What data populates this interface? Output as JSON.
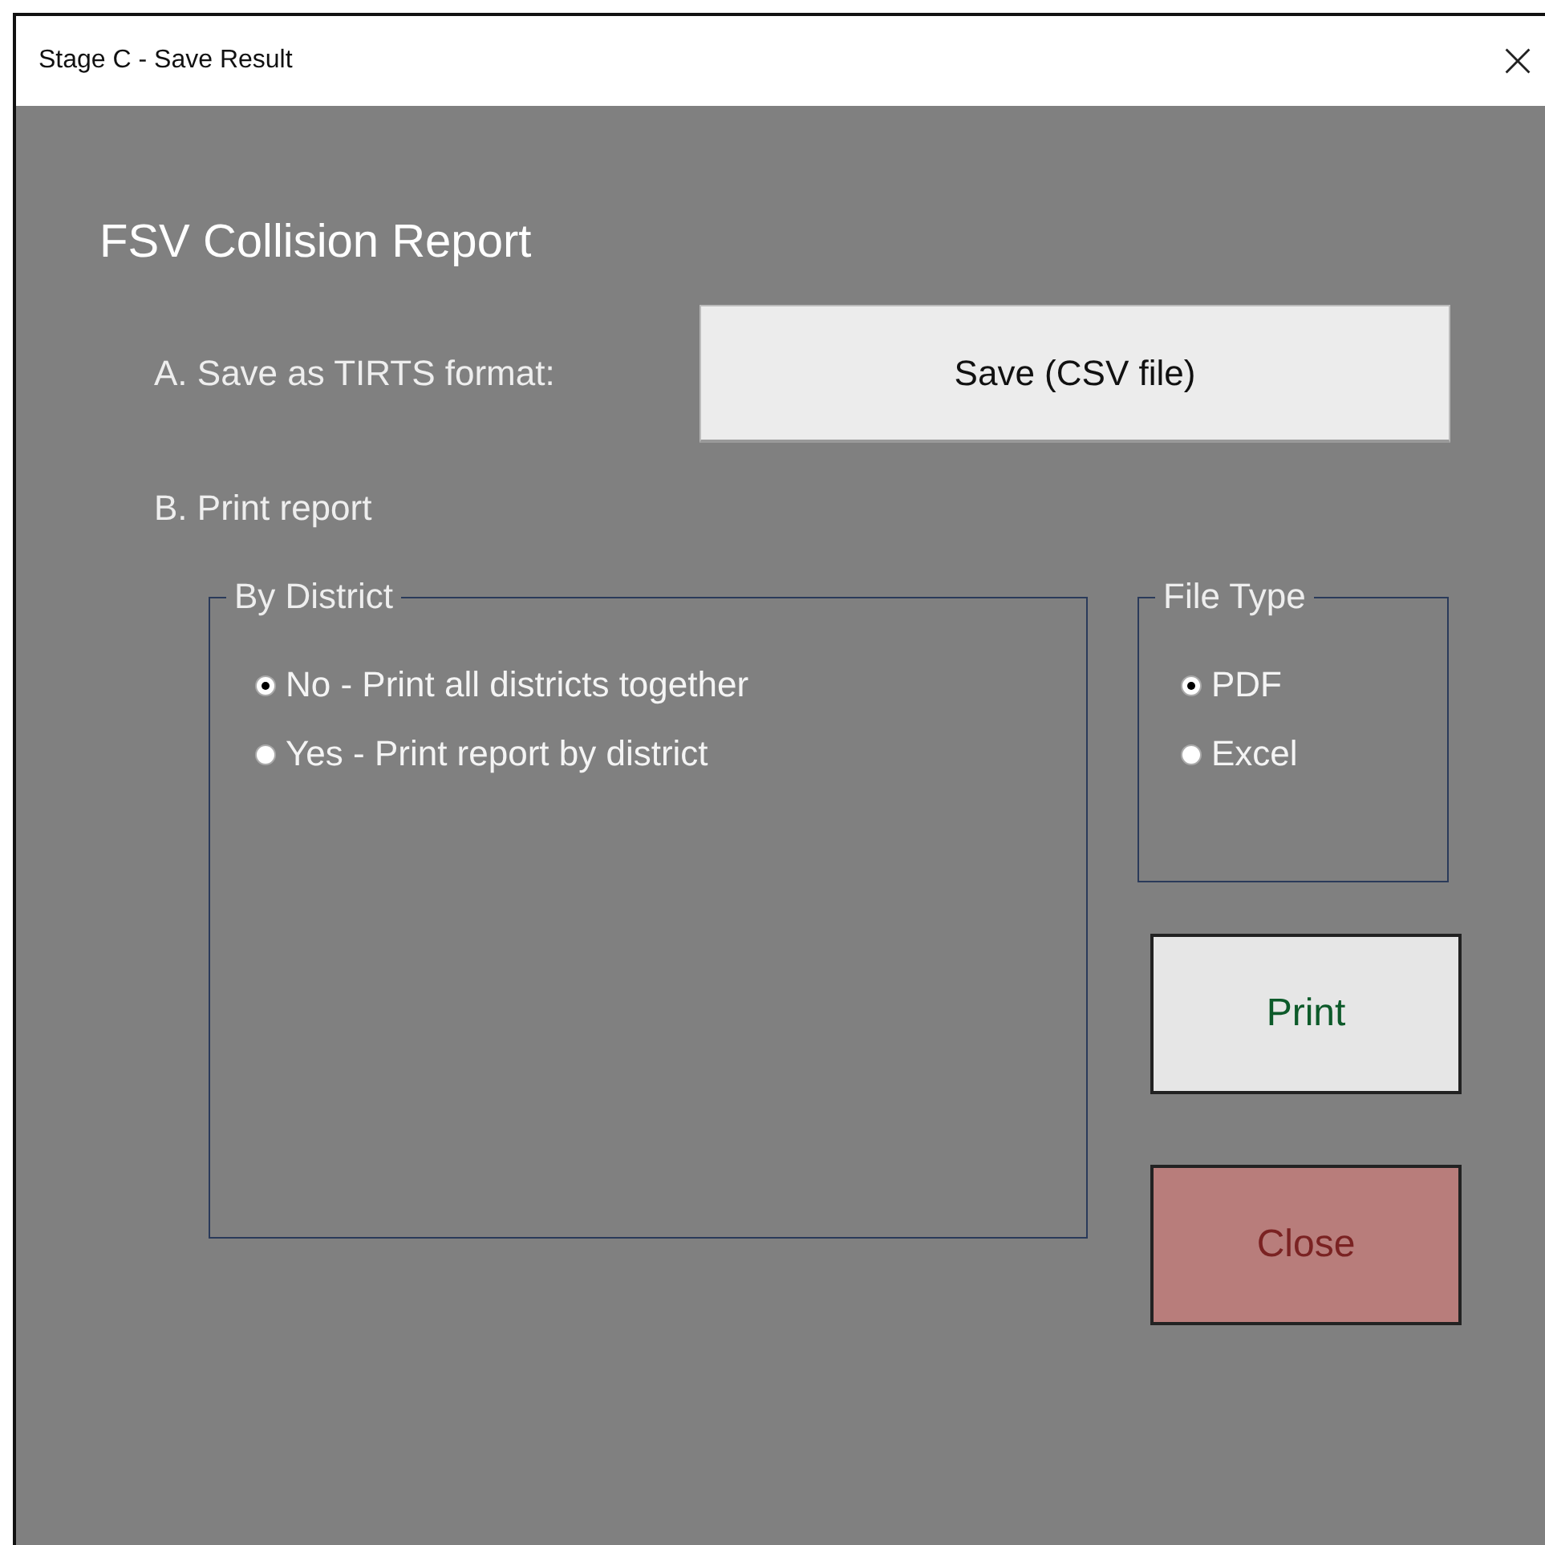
{
  "window": {
    "title": "Stage C - Save Result"
  },
  "heading": "FSV Collision Report",
  "section_a": {
    "label": "A. Save as TIRTS format:",
    "button": "Save (CSV file)"
  },
  "section_b": {
    "label": "B. Print report"
  },
  "district_group": {
    "title": "By District",
    "options": [
      {
        "label": "No - Print all districts together",
        "selected": true
      },
      {
        "label": "Yes - Print report by district",
        "selected": false
      }
    ]
  },
  "file_type_group": {
    "title": "File Type",
    "options": [
      {
        "label": "PDF",
        "selected": true
      },
      {
        "label": "Excel",
        "selected": false
      }
    ]
  },
  "buttons": [
    {
      "label": "Print",
      "kind": "print"
    },
    {
      "label": "Close",
      "kind": "close"
    }
  ]
}
